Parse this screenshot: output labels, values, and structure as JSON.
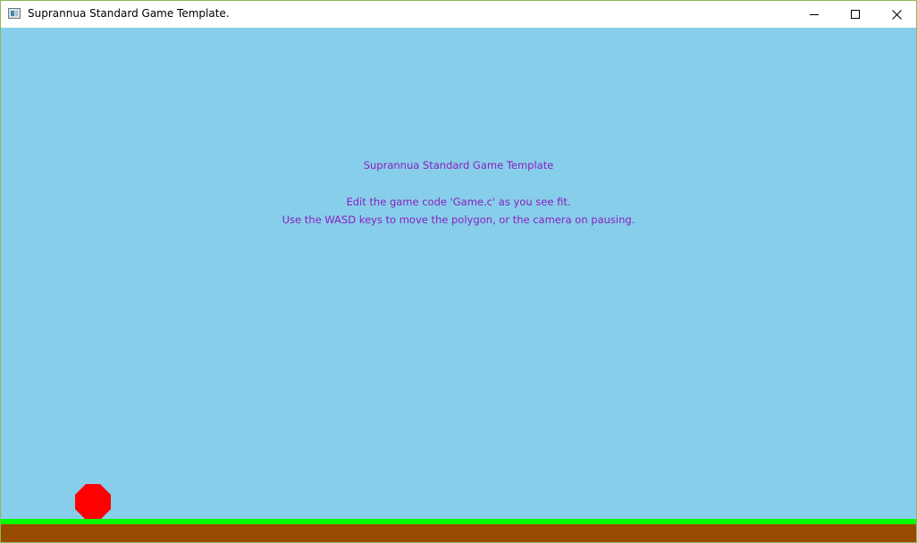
{
  "window": {
    "title": "Suprannua Standard Game Template.",
    "icon": "app-window-icon",
    "controls": [
      "minimize-icon",
      "maximize-icon",
      "close-icon"
    ]
  },
  "game": {
    "title": "Suprannua Standard Game Template",
    "instruction_1": "Edit the game code 'Game.c' as you see fit.",
    "instruction_2": "Use the WASD keys to move the polygon, or the camera on pausing.",
    "colors": {
      "sky": "#87ceeb",
      "text": "#8a1fc0",
      "player": "#ff0000",
      "grass": "#00ff00",
      "dirt": "#964b00"
    },
    "player_shape": "octagon"
  }
}
